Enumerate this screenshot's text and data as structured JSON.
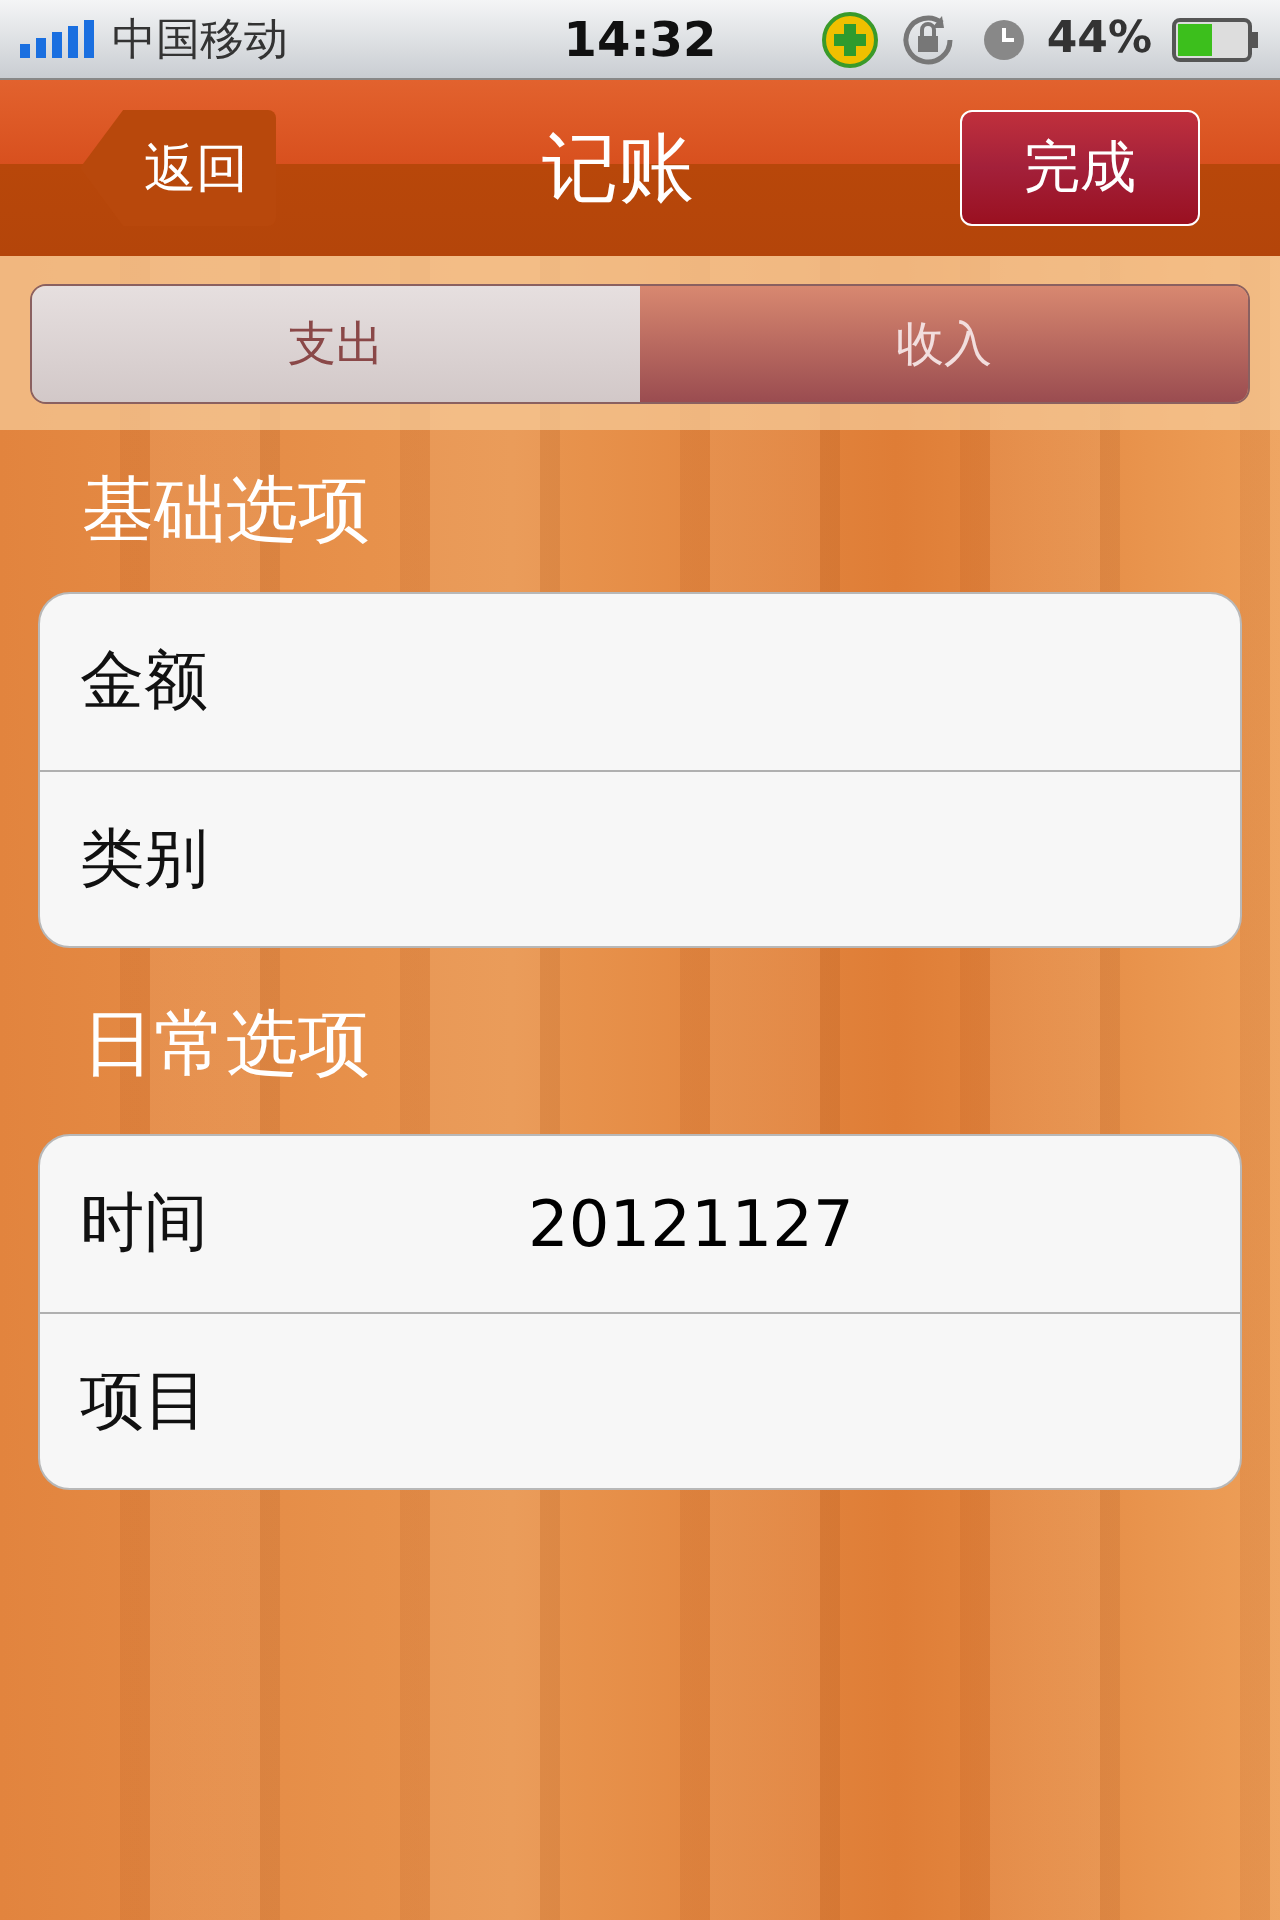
{
  "status_bar": {
    "carrier": "中国移动",
    "time": "14:32",
    "battery": "44%"
  },
  "nav_bar": {
    "back": "返回",
    "title": "记账",
    "done": "完成"
  },
  "segments": [
    {
      "label": "支出",
      "selected": false
    },
    {
      "label": "收入",
      "selected": true
    }
  ],
  "sections": [
    {
      "title": "基础选项",
      "rows": [
        {
          "label": "金额"
        },
        {
          "label": "类别"
        }
      ]
    },
    {
      "title": "日常选项",
      "rows": [
        {
          "label": "时间",
          "value": "20121127"
        },
        {
          "label": "项目"
        }
      ]
    }
  ]
}
